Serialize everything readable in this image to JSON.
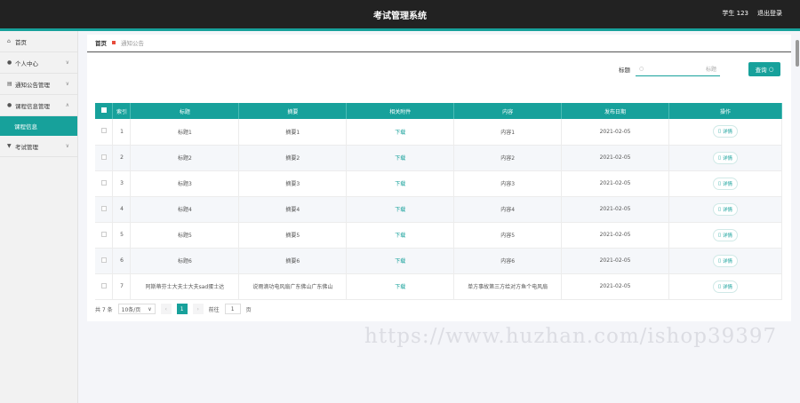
{
  "header": {
    "title": "考试管理系统",
    "user": "学生 123",
    "logout": "退出登录"
  },
  "sidebar": {
    "items": [
      {
        "label": "首页",
        "icon": "home-icon"
      },
      {
        "label": "个人中心",
        "icon": "user-icon"
      },
      {
        "label": "通知公告管理",
        "icon": "list-icon"
      },
      {
        "label": "课程信息管理",
        "icon": "user-icon"
      },
      {
        "label": "考试管理",
        "icon": "filter-icon"
      }
    ],
    "active_sub": "课程信息"
  },
  "breadcrumb": {
    "home": "首页",
    "current": "通知公告"
  },
  "search": {
    "label": "标题",
    "placeholder": "标题",
    "button": "查询"
  },
  "table": {
    "headers": [
      "索引",
      "标题",
      "摘要",
      "相关附件",
      "内容",
      "发布日期",
      "操作"
    ],
    "rows": [
      {
        "idx": "1",
        "title": "标题1",
        "summary": "摘要1",
        "attach": "下载",
        "content": "内容1",
        "date": "2021-02-05",
        "op": "详情"
      },
      {
        "idx": "2",
        "title": "标题2",
        "summary": "摘要2",
        "attach": "下载",
        "content": "内容2",
        "date": "2021-02-05",
        "op": "详情"
      },
      {
        "idx": "3",
        "title": "标题3",
        "summary": "摘要3",
        "attach": "下载",
        "content": "内容3",
        "date": "2021-02-05",
        "op": "详情"
      },
      {
        "idx": "4",
        "title": "标题4",
        "summary": "摘要4",
        "attach": "下载",
        "content": "内容4",
        "date": "2021-02-05",
        "op": "详情"
      },
      {
        "idx": "5",
        "title": "标题5",
        "summary": "摘要5",
        "attach": "下载",
        "content": "内容5",
        "date": "2021-02-05",
        "op": "详情"
      },
      {
        "idx": "6",
        "title": "标题6",
        "summary": "摘要6",
        "attach": "下载",
        "content": "内容6",
        "date": "2021-02-05",
        "op": "详情"
      },
      {
        "idx": "7",
        "title": "阿斯蒂芬士大夫士大夫sad蛋士达",
        "summary": "说雨滴功电风扇广东佛山广东佛山",
        "attach": "下载",
        "content": "单方事故第三方给对方鱼个电风扇",
        "date": "2021-02-05",
        "op": "详情"
      }
    ]
  },
  "pager": {
    "total": "共 7 条",
    "size": "10条/页",
    "current": "1",
    "goto_label": "前往",
    "goto_value": "1",
    "page_suffix": "页"
  },
  "watermark": "https://www.huzhan.com/ishop39397",
  "colors": {
    "accent": "#17a19b",
    "header": "#222222"
  }
}
